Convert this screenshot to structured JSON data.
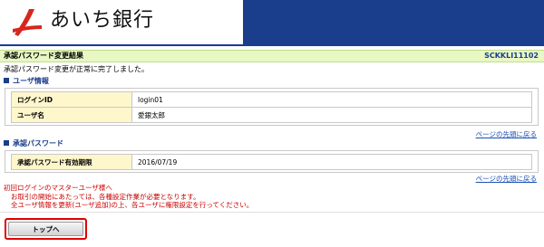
{
  "header": {
    "brand_name": "あいち銀行",
    "colors": {
      "band": "#1a3d8c",
      "logo_mark": "#d7261e"
    }
  },
  "page": {
    "title": "承認パスワード変更結果",
    "screen_code": "SCKKLI11102",
    "message": "承認パスワード変更が正常に完了しました。"
  },
  "user_section": {
    "heading": "ユーザ情報",
    "rows": [
      {
        "label": "ログインID",
        "value": "login01"
      },
      {
        "label": "ユーザ名",
        "value": "愛銀太郎"
      }
    ],
    "page_top_link": "ページの先頭に戻る"
  },
  "password_section": {
    "heading": "承認パスワード",
    "rows": [
      {
        "label": "承認パスワード有効期限",
        "value": "2016/07/19"
      }
    ],
    "page_top_link": "ページの先頭に戻る"
  },
  "notes": [
    "初回ログインのマスターユーザ様へ",
    "お取引の開始にあたっては、各種設定作業が必要となります。",
    "全ユーザ情報を更新(ユーザ追加)の上、各ユーザに権限設定を行ってください。"
  ],
  "buttons": {
    "top": "トップへ"
  }
}
